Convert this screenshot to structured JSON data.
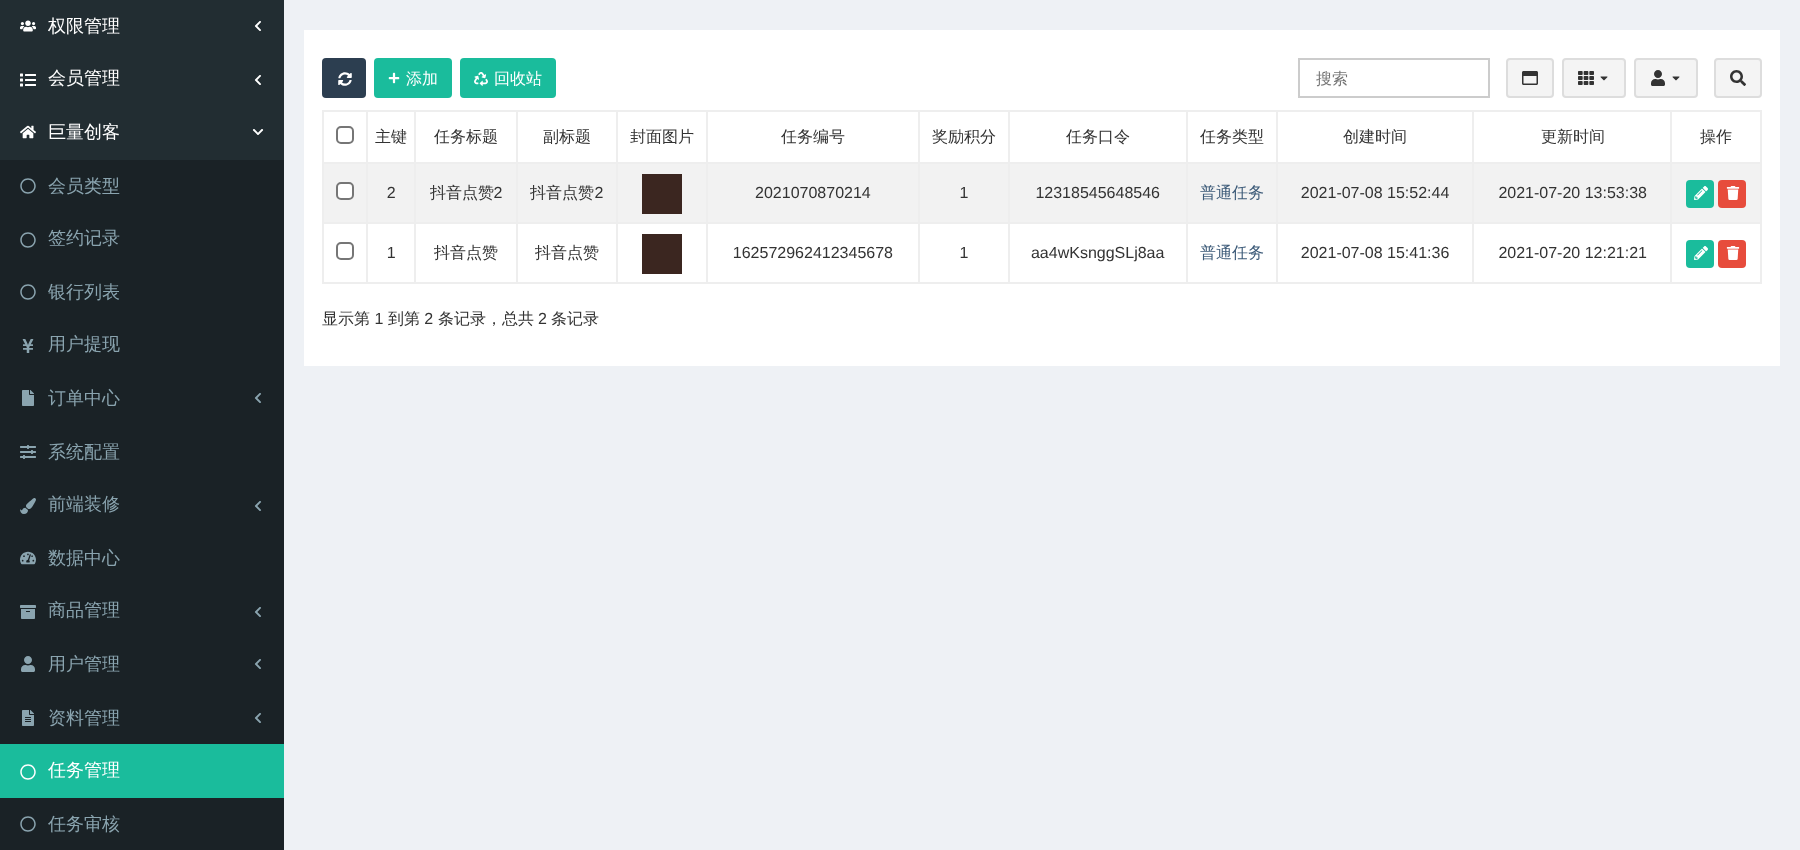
{
  "sidebar": {
    "items": [
      {
        "label": "权限管理",
        "expanded": false
      },
      {
        "label": "会员管理",
        "expanded": false
      },
      {
        "label": "巨量创客",
        "expanded": true,
        "children": [
          {
            "label": "会员类型",
            "selected": false
          },
          {
            "label": "签约记录",
            "selected": false
          },
          {
            "label": "银行列表",
            "selected": false
          },
          {
            "label": "用户提现",
            "selected": false
          },
          {
            "label": "订单中心",
            "selected": false,
            "expanded": false
          },
          {
            "label": "系统配置",
            "selected": false
          },
          {
            "label": "前端装修",
            "selected": false,
            "expanded": false
          },
          {
            "label": "数据中心",
            "selected": false
          },
          {
            "label": "商品管理",
            "selected": false,
            "expanded": false
          },
          {
            "label": "用户管理",
            "selected": false,
            "expanded": false
          },
          {
            "label": "资料管理",
            "selected": false,
            "expanded": false
          },
          {
            "label": "任务管理",
            "selected": true
          },
          {
            "label": "任务审核",
            "selected": false
          }
        ]
      }
    ]
  },
  "toolbar": {
    "add": "添加",
    "recycle": "回收站",
    "search": {
      "placeholder": "搜索"
    }
  },
  "table": {
    "select_all_checked": false,
    "columns": [
      "主键",
      "任务标题",
      "副标题",
      "封面图片",
      "任务编号",
      "奖励积分",
      "任务口令",
      "任务类型",
      "创建时间",
      "更新时间",
      "操作"
    ],
    "rows": [
      {
        "checked": false,
        "highlighted": true,
        "cells": [
          "2",
          "抖音点赞2",
          "抖音点赞2",
          "",
          "2021070870214",
          "1",
          "12318545648546",
          "普通任务",
          "2021-07-08 15:52:44",
          "2021-07-20 13:53:38"
        ]
      },
      {
        "checked": false,
        "highlighted": false,
        "cells": [
          "1",
          "抖音点赞",
          "抖音点赞",
          "",
          "162572962412345678",
          "1",
          "aa4wKsnggSLj8aa",
          "普通任务",
          "2021-07-08 15:41:36",
          "2021-07-20 12:21:21"
        ]
      }
    ]
  },
  "footer": "显示第 1 到第 2 条记录，总共 2 条记录"
}
